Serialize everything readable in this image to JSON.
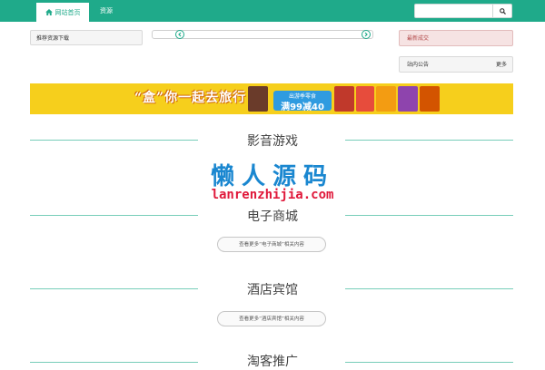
{
  "nav": {
    "home_label": "网站首页",
    "resources_label": "资源",
    "search_placeholder": ""
  },
  "panels": {
    "recommended_downloads": "推荐资源下载",
    "latest_deals": "最新成交",
    "site_notice": "站内公告",
    "more": "更多"
  },
  "banner": {
    "title": "“盒”你一起去旅行",
    "tag_top": "出游季零食",
    "tag_main": "满99减40"
  },
  "sections": [
    {
      "title": "影音游戏",
      "more_label": ""
    },
    {
      "title": "电子商城",
      "more_label": "查看更多“电子商城”相关内容"
    },
    {
      "title": "酒店宾馆",
      "more_label": "查看更多“酒店宾馆”相关内容"
    },
    {
      "title": "淘客推广",
      "more_label": ""
    }
  ],
  "watermark": {
    "cn": "懒人源码",
    "en": "lanrenzhijia.com"
  },
  "colors": {
    "brand": "#1faa8a",
    "banner": "#f6cf1c",
    "deal_bg": "#f6e3e3"
  }
}
